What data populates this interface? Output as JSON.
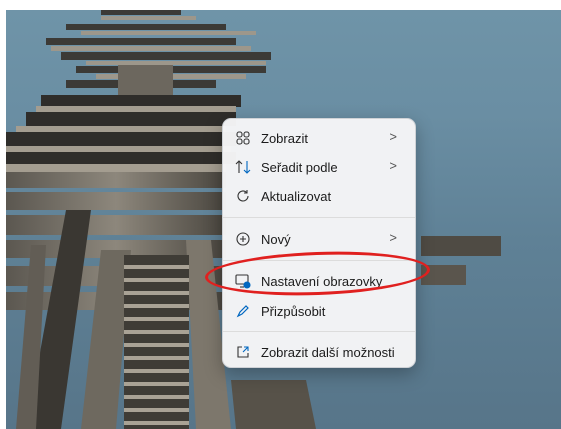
{
  "menu": {
    "items": [
      {
        "label": "Zobrazit",
        "icon": "grid-view-icon",
        "has_submenu": true
      },
      {
        "label": "Seřadit podle",
        "icon": "sort-arrows-icon",
        "has_submenu": true
      },
      {
        "label": "Aktualizovat",
        "icon": "refresh-icon",
        "has_submenu": false
      },
      {
        "label": "Nový",
        "icon": "add-circle-icon",
        "has_submenu": true
      },
      {
        "label": "Nastavení obrazovky",
        "icon": "display-settings-icon",
        "has_submenu": false
      },
      {
        "label": "Přizpůsobit",
        "icon": "pen-icon",
        "has_submenu": false
      },
      {
        "label": "Zobrazit další možnosti",
        "icon": "open-external-icon",
        "has_submenu": false
      }
    ],
    "submenu_chevron": ">"
  },
  "colors": {
    "accent": "#0067c0",
    "highlight_ring": "#e0201f",
    "menu_bg": "#f6f6f7",
    "water": "#6a8ea3"
  }
}
